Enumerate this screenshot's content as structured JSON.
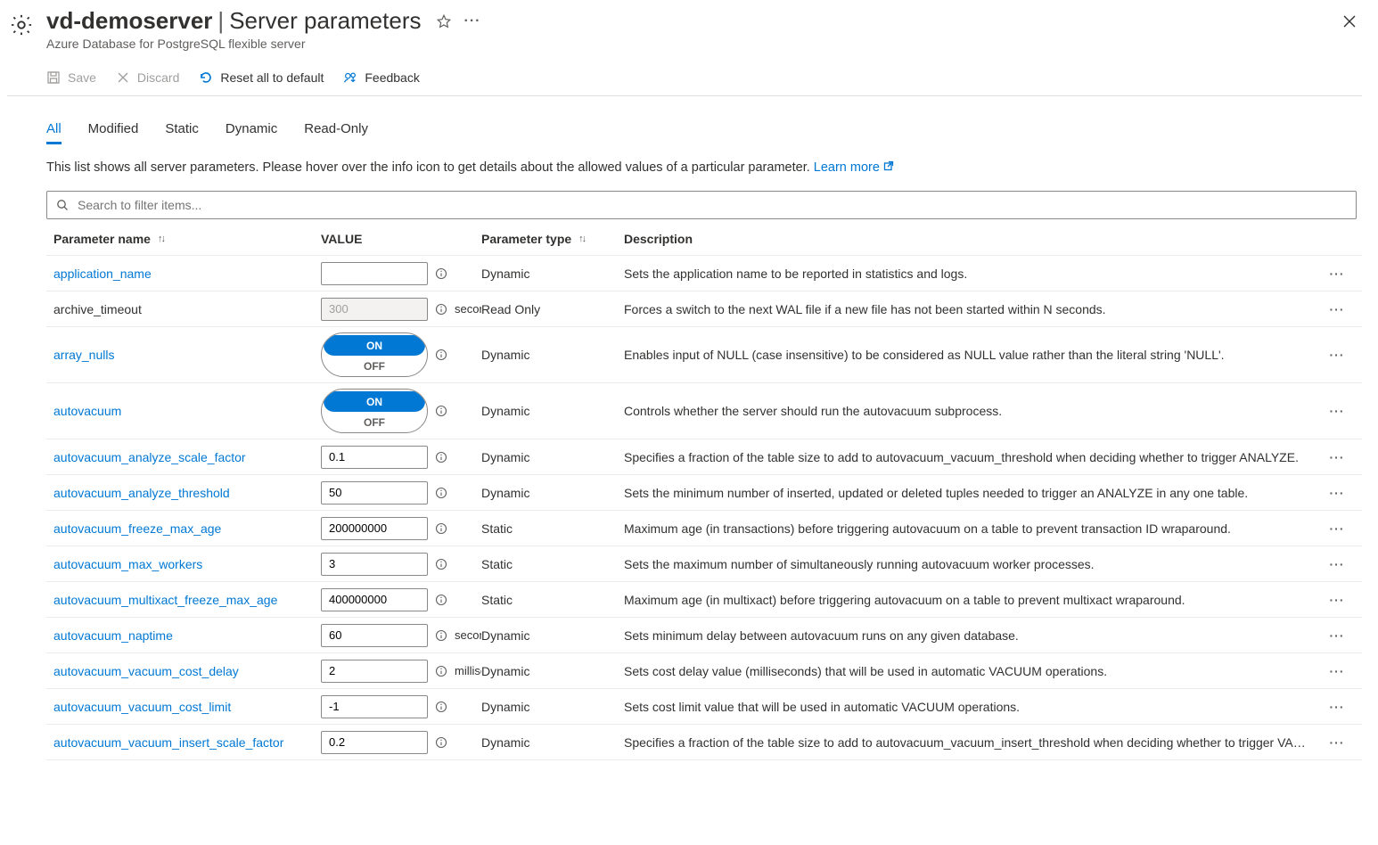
{
  "header": {
    "resource_name": "vd-demoserver",
    "page_title": "Server parameters",
    "subtitle": "Azure Database for PostgreSQL flexible server"
  },
  "toolbar": {
    "save": "Save",
    "discard": "Discard",
    "reset": "Reset all to default",
    "feedback": "Feedback"
  },
  "tabs": [
    "All",
    "Modified",
    "Static",
    "Dynamic",
    "Read-Only"
  ],
  "active_tab": "All",
  "helptext": {
    "text": "This list shows all server parameters. Please hover over the info icon to get details about the allowed values of a particular parameter.",
    "link_label": "Learn more"
  },
  "search": {
    "placeholder": "Search to filter items..."
  },
  "columns": {
    "name": "Parameter name",
    "value": "VALUE",
    "type": "Parameter type",
    "desc": "Description"
  },
  "toggle_labels": {
    "on": "ON",
    "off": "OFF"
  },
  "rows": [
    {
      "name": "application_name",
      "kind": "text",
      "value": "",
      "unit": "",
      "type": "Dynamic",
      "readonly": false,
      "desc": "Sets the application name to be reported in statistics and logs."
    },
    {
      "name": "archive_timeout",
      "kind": "text",
      "value": "300",
      "unit": "seconds",
      "type": "Read Only",
      "readonly": true,
      "desc": "Forces a switch to the next WAL file if a new file has not been started within N seconds."
    },
    {
      "name": "array_nulls",
      "kind": "toggle",
      "value": "ON",
      "unit": "",
      "type": "Dynamic",
      "readonly": false,
      "desc": "Enables input of NULL (case insensitive) to be considered as NULL value rather than the literal string 'NULL'."
    },
    {
      "name": "autovacuum",
      "kind": "toggle",
      "value": "ON",
      "unit": "",
      "type": "Dynamic",
      "readonly": false,
      "desc": "Controls whether the server should run the autovacuum subprocess."
    },
    {
      "name": "autovacuum_analyze_scale_factor",
      "kind": "text",
      "value": "0.1",
      "unit": "",
      "type": "Dynamic",
      "readonly": false,
      "desc": "Specifies a fraction of the table size to add to autovacuum_vacuum_threshold when deciding whether to trigger ANALYZE."
    },
    {
      "name": "autovacuum_analyze_threshold",
      "kind": "text",
      "value": "50",
      "unit": "",
      "type": "Dynamic",
      "readonly": false,
      "desc": "Sets the minimum number of inserted, updated or deleted tuples needed to trigger an ANALYZE in any one table."
    },
    {
      "name": "autovacuum_freeze_max_age",
      "kind": "text",
      "value": "200000000",
      "unit": "",
      "type": "Static",
      "readonly": false,
      "desc": "Maximum age (in transactions) before triggering autovacuum on a table to prevent transaction ID wraparound."
    },
    {
      "name": "autovacuum_max_workers",
      "kind": "text",
      "value": "3",
      "unit": "",
      "type": "Static",
      "readonly": false,
      "desc": "Sets the maximum number of simultaneously running autovacuum worker processes."
    },
    {
      "name": "autovacuum_multixact_freeze_max_age",
      "kind": "text",
      "value": "400000000",
      "unit": "",
      "type": "Static",
      "readonly": false,
      "desc": "Maximum age (in multixact) before triggering autovacuum on a table to prevent multixact wraparound."
    },
    {
      "name": "autovacuum_naptime",
      "kind": "text",
      "value": "60",
      "unit": "seconds",
      "type": "Dynamic",
      "readonly": false,
      "desc": "Sets minimum delay between autovacuum runs on any given database."
    },
    {
      "name": "autovacuum_vacuum_cost_delay",
      "kind": "text",
      "value": "2",
      "unit": "milliseconds",
      "type": "Dynamic",
      "readonly": false,
      "desc": "Sets cost delay value (milliseconds) that will be used in automatic VACUUM operations."
    },
    {
      "name": "autovacuum_vacuum_cost_limit",
      "kind": "text",
      "value": "-1",
      "unit": "",
      "type": "Dynamic",
      "readonly": false,
      "desc": "Sets cost limit value that will be used in automatic VACUUM operations."
    },
    {
      "name": "autovacuum_vacuum_insert_scale_factor",
      "kind": "text",
      "value": "0.2",
      "unit": "",
      "type": "Dynamic",
      "readonly": false,
      "desc": "Specifies a fraction of the table size to add to autovacuum_vacuum_insert_threshold when deciding whether to trigger VACUUM."
    }
  ]
}
